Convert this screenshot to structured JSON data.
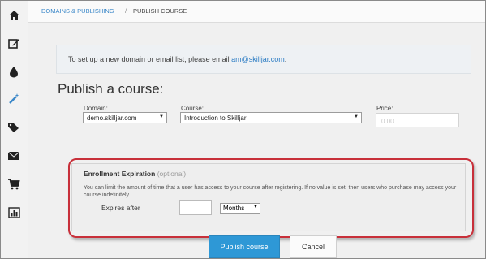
{
  "sidebar": {
    "icons": [
      "home-icon",
      "edit-icon",
      "drop-icon",
      "magic-wand-icon",
      "tags-icon",
      "envelope-icon",
      "cart-icon",
      "bar-chart-icon"
    ],
    "active_index": 3,
    "accent_color": "#3a87c8"
  },
  "breadcrumb": {
    "parent": "DOMAINS & PUBLISHING",
    "separator": "/",
    "current": "PUBLISH COURSE"
  },
  "notice": {
    "text": "To set up a new domain or email list, please email ",
    "email": "am@skilljar.com",
    "suffix": "."
  },
  "page_title": "Publish a course:",
  "form": {
    "domain_label": "Domain:",
    "domain_value": "demo.skilljar.com",
    "course_label": "Course:",
    "course_value": "Introduction to Skilljar",
    "price_label": "Price:",
    "price_placeholder": "0.00"
  },
  "expiration": {
    "title": "Enrollment Expiration",
    "optional": "(optional)",
    "description": "You can limit the amount of time that a user has access to your course after registering. If no value is set, then users who purchase may access your course indefinitely.",
    "expires_label": "Expires after",
    "expires_value": "",
    "unit_value": "Months",
    "highlight_color": "#c8303a"
  },
  "actions": {
    "publish_label": "Publish course",
    "cancel_label": "Cancel",
    "publish_color": "#2e98d6"
  }
}
